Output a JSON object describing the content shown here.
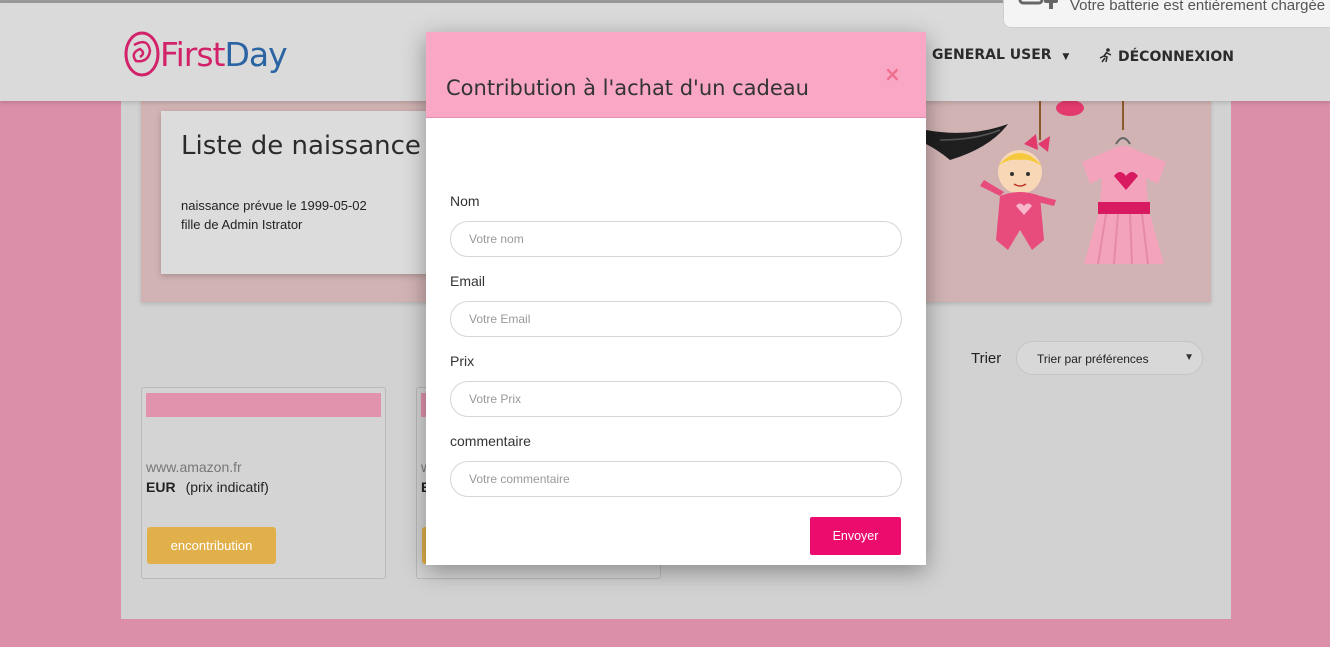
{
  "colors": {
    "page_background": "#dc8fa8",
    "modal_header": "#f9a7c4",
    "primary_button": "#ec0c6e",
    "contribution_button": "#e2b04a",
    "logo_first": "#d2236a",
    "logo_day": "#2b64a3"
  },
  "notification": {
    "text": "Votre batterie est entièrement chargée",
    "icon": "battery-plug-icon"
  },
  "navbar": {
    "logo_first": "First",
    "logo_day": "Day",
    "user_menu": "GENERAL USER",
    "logout": "DÉCONNEXION",
    "logout_icon": "running-person-icon"
  },
  "hero": {
    "title": "Liste de naissance de",
    "due_date_line": "naissance prévue le 1999-05-02",
    "parents_line": "fille de Admin Istrator"
  },
  "sort": {
    "label": "Trier",
    "selected": "Trier par préférences"
  },
  "products": [
    {
      "site": "www.amazon.fr",
      "currency": "EUR",
      "price_note": "(prix indicatif)",
      "button": "encontribution"
    },
    {
      "site": "ww",
      "currency": "E",
      "price_note": "",
      "button": ""
    }
  ],
  "modal": {
    "title": "Contribution à l'achat d'un cadeau",
    "close_glyph": "×",
    "fields": {
      "name_label": "Nom",
      "name_placeholder": "Votre nom",
      "email_label": "Email",
      "email_placeholder": "Votre Email",
      "price_label": "Prix",
      "price_placeholder": "Votre Prix",
      "comment_label": "commentaire",
      "comment_placeholder": "Votre commentaire"
    },
    "submit_label": "Envoyer"
  }
}
